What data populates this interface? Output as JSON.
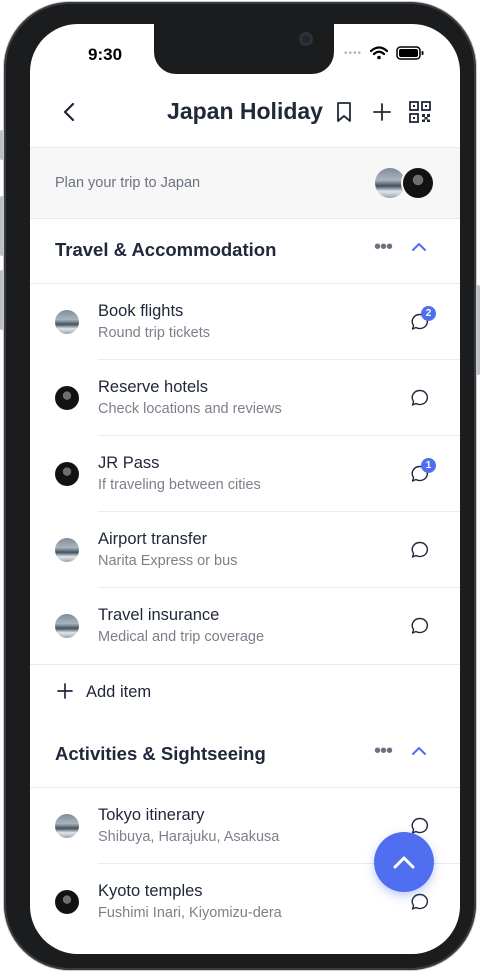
{
  "status_bar": {
    "time": "9:30",
    "signal": "••••"
  },
  "header": {
    "title": "Japan Holiday",
    "back_icon": "chevron-left-icon",
    "actions": [
      "bookmark-icon",
      "plus-icon",
      "qr-code-icon"
    ]
  },
  "subheader": {
    "text": "Plan your trip to Japan",
    "avatars": [
      "landscape",
      "person"
    ]
  },
  "sections": [
    {
      "title": "Travel & Accommodation",
      "items": [
        {
          "title": "Book flights",
          "subtitle": "Round trip tickets",
          "avatar": "landscape",
          "badge": "2"
        },
        {
          "title": "Reserve hotels",
          "subtitle": "Check locations and reviews",
          "avatar": "person",
          "badge": ""
        },
        {
          "title": "JR Pass",
          "subtitle": "If traveling between cities",
          "avatar": "person",
          "badge": "1"
        },
        {
          "title": "Airport transfer",
          "subtitle": "Narita Express or bus",
          "avatar": "landscape",
          "badge": ""
        },
        {
          "title": "Travel insurance",
          "subtitle": "Medical and trip coverage",
          "avatar": "landscape",
          "badge": ""
        }
      ],
      "add_label": "Add item"
    },
    {
      "title": "Activities & Sightseeing",
      "items": [
        {
          "title": "Tokyo itinerary",
          "subtitle": "Shibuya, Harajuku, Asakusa",
          "avatar": "landscape",
          "badge": ""
        },
        {
          "title": "Kyoto temples",
          "subtitle": "Fushimi Inari, Kiyomizu-dera",
          "avatar": "person",
          "badge": ""
        }
      ]
    }
  ],
  "colors": {
    "accent": "#4f6ff0",
    "text": "#20283a",
    "muted": "#7b808a"
  }
}
